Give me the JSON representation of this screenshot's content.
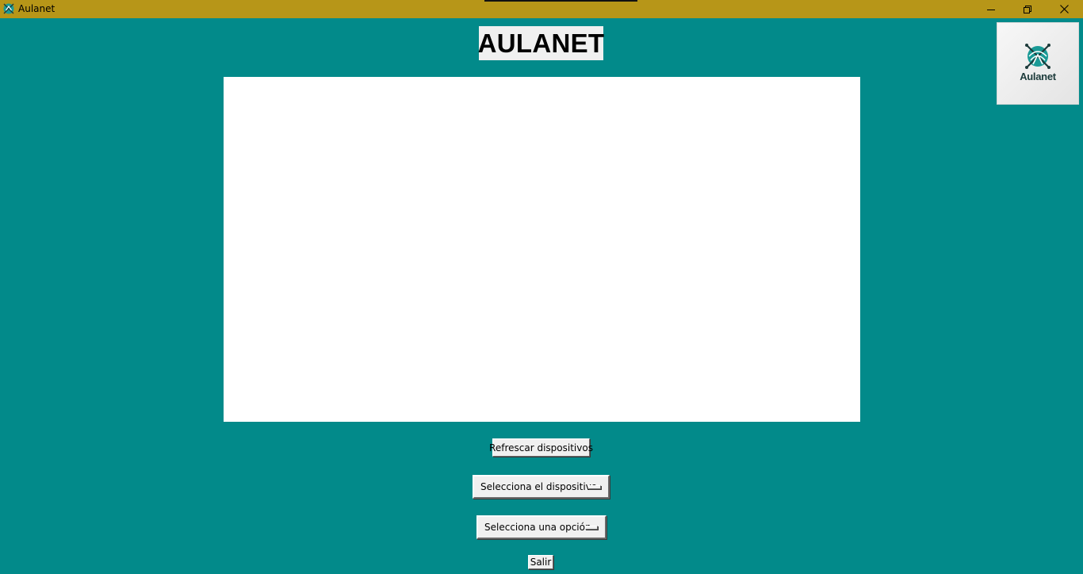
{
  "window": {
    "title": "Aulanet",
    "icon": "aulanet-logo-icon",
    "controls": [
      "minimize-icon",
      "restore-icon",
      "close-icon"
    ]
  },
  "header": {
    "heading": "AULANET"
  },
  "logo": {
    "word": "Aulanet",
    "icon": "aulanet-logo-mark"
  },
  "controls": {
    "refresh_label": "Refrescar dispositivos",
    "device_menu_label": "Selecciona el dispositivo",
    "option_menu_label": "Selecciona una opción",
    "exit_label": "Salir"
  },
  "colors": {
    "background": "#028a8a",
    "titlebar": "#b79618",
    "panel": "#ffffff",
    "logo_accent": "#1a9a96"
  }
}
